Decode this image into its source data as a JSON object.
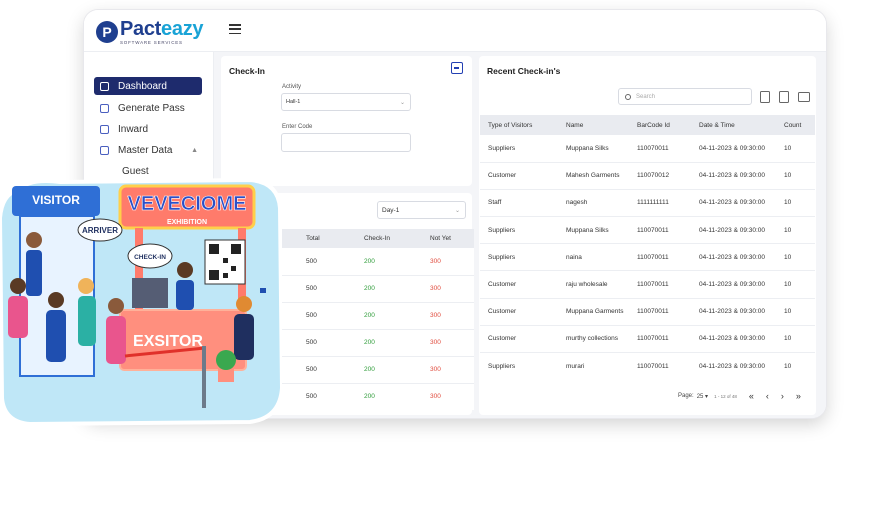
{
  "brand": {
    "name_part1": "Pact",
    "name_part2": "eazy",
    "tagline": "SOFTWARE SERVICES",
    "mark": "P"
  },
  "colors": {
    "primary": "#1e2b6d",
    "accent": "#19a3d6",
    "green": "#2e9c39",
    "red": "#e04a3c"
  },
  "sidebar": {
    "items": [
      {
        "label": "Dashboard",
        "icon": "dashboard-icon",
        "active": true
      },
      {
        "label": "Generate Pass",
        "icon": "pass-icon"
      },
      {
        "label": "Inward",
        "icon": "inward-icon"
      },
      {
        "label": "Master Data",
        "icon": "master-data-icon"
      }
    ],
    "sub_items": [
      "Guest"
    ]
  },
  "checkin": {
    "title": "Check-In",
    "activity_label": "Activity",
    "activity_value": "Hall-1",
    "code_label": "Enter Code",
    "code_value": ""
  },
  "stats": {
    "day_select": "Day-1",
    "columns": [
      "Total",
      "Check-In",
      "Not Yet"
    ],
    "rows": [
      [
        "500",
        "200",
        "300"
      ],
      [
        "500",
        "200",
        "300"
      ],
      [
        "500",
        "200",
        "300"
      ],
      [
        "500",
        "200",
        "300"
      ],
      [
        "500",
        "200",
        "300"
      ],
      [
        "500",
        "200",
        "300"
      ]
    ]
  },
  "recent": {
    "title": "Recent Check-in's",
    "search_placeholder": "Search",
    "columns": [
      "Type of Visitors",
      "Name",
      "BarCode Id",
      "Date & Time",
      "Count"
    ],
    "rows": [
      [
        "Suppliers",
        "Muppana Silks",
        "110070011",
        "04-11-2023 & 09:30:00",
        "10"
      ],
      [
        "Customer",
        "Mahesh Garments",
        "110070012",
        "04-11-2023 & 09:30:00",
        "10"
      ],
      [
        "Staff",
        "nagesh",
        "1111111111",
        "04-11-2023 & 09:30:00",
        "10"
      ],
      [
        "Suppliers",
        "Muppana Silks",
        "110070011",
        "04-11-2023 & 09:30:00",
        "10"
      ],
      [
        "Suppliers",
        "naina",
        "110070011",
        "04-11-2023 & 09:30:00",
        "10"
      ],
      [
        "Customer",
        "raju wholesale",
        "110070011",
        "04-11-2023 & 09:30:00",
        "10"
      ],
      [
        "Customer",
        "Muppana Garments",
        "110070011",
        "04-11-2023 & 09:30:00",
        "10"
      ],
      [
        "Customer",
        "murthy collections",
        "110070011",
        "04-11-2023 & 09:30:00",
        "10"
      ],
      [
        "Suppliers",
        "murari",
        "110070011",
        "04-11-2023 & 09:30:00",
        "10"
      ]
    ],
    "pagination": {
      "label": "Page:",
      "page": "25",
      "range": "1 - 12 of 48"
    }
  },
  "illustration": {
    "sign_visitor": "VISITOR",
    "sign_welcome": "VEVECIOME",
    "sign_exhibition": "EXHIBITION",
    "bubble_arriver": "ARRIVER",
    "bubble_checkin": "CHECK-IN",
    "desk_text": "EXSITOR"
  }
}
